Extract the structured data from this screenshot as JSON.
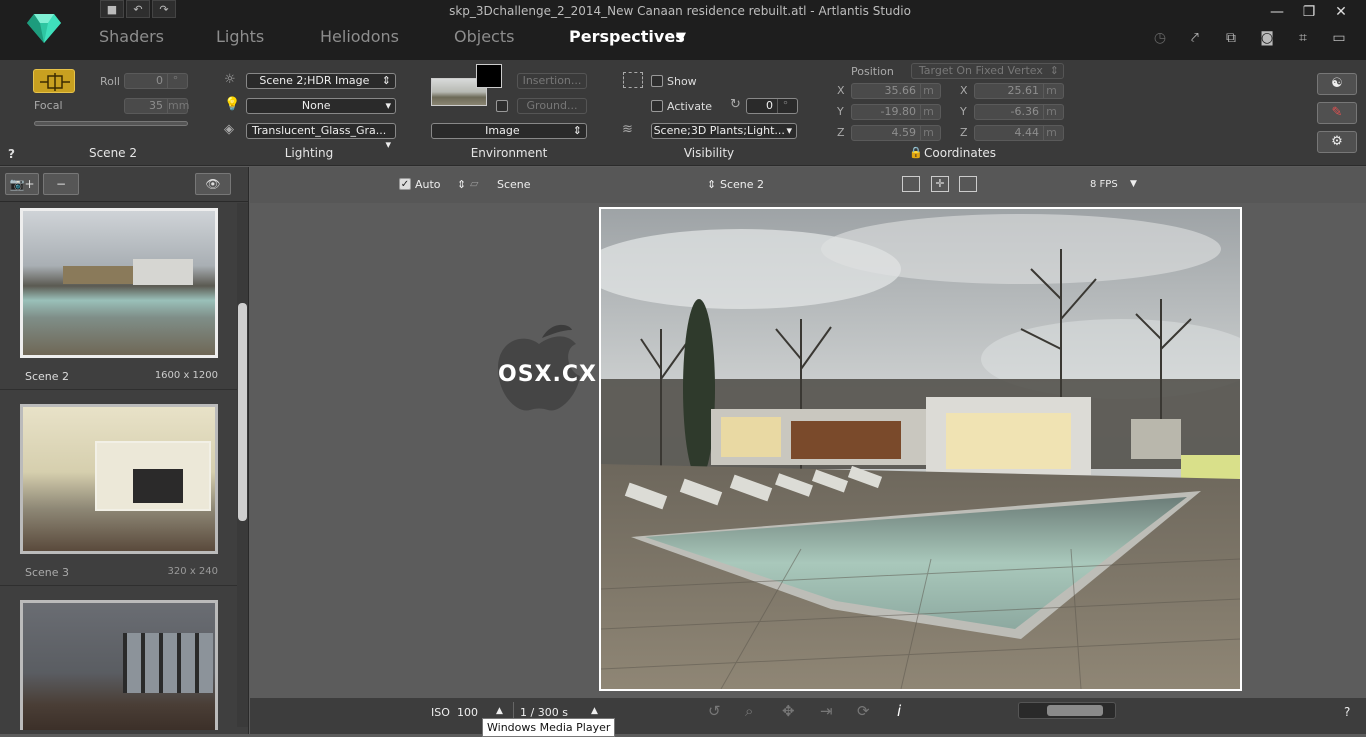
{
  "window": {
    "title": "skp_3Dchallenge_2_2014_New Canaan residence rebuilt.atl - Artlantis Studio",
    "controls": {
      "minimize": "—",
      "maximize": "❐",
      "close": "✕"
    }
  },
  "tabs": [
    {
      "label": "Shaders"
    },
    {
      "label": "Lights"
    },
    {
      "label": "Heliodons"
    },
    {
      "label": "Objects"
    },
    {
      "label": "Perspectives",
      "active": true
    }
  ],
  "tab_menu_arrow": "▼",
  "toolbar": {
    "scene": {
      "section_label": "Scene 2",
      "roll_label": "Roll",
      "roll_value": "0",
      "roll_unit": "°",
      "focal_label": "Focal",
      "focal_value": "35",
      "focal_unit": "mm"
    },
    "lighting": {
      "section_label": "Lighting",
      "heliodon_select": "Scene 2;HDR Image",
      "light_select": "None",
      "shader_select": "Translucent_Glass_Gra..."
    },
    "environment": {
      "section_label": "Environment",
      "mode_select": "Image",
      "insertion_button": "Insertion...",
      "ground_button": "Ground..."
    },
    "visibility": {
      "section_label": "Visibility",
      "show_label": "Show",
      "activate_label": "Activate",
      "angle_value": "0",
      "angle_unit": "°",
      "layers_select": "Scene;3D Plants;Light..."
    },
    "coordinates": {
      "section_label": "Coordinates",
      "position_label": "Position",
      "target_select": "Target On Fixed Vertex",
      "position": {
        "x": "35.66",
        "y": "-19.80",
        "z": "4.59"
      },
      "target": {
        "x": "25.61",
        "y": "-6.36",
        "z": "4.44"
      },
      "unit": "m",
      "axis_labels": {
        "x": "X",
        "y": "Y",
        "z": "Z"
      }
    },
    "help": "?"
  },
  "sidebar": {
    "add_button": "📷+",
    "remove_button": "−",
    "eye_button": "👁",
    "scenes": [
      {
        "name": "Scene 2",
        "size": "1600 x 1200",
        "active": true
      },
      {
        "name": "Scene 3",
        "size": "320 x 240",
        "active": false
      },
      {
        "name": "",
        "size": "",
        "active": false
      }
    ]
  },
  "viewport_header": {
    "auto_label": "Auto",
    "heliodon_scene": "Scene",
    "scene_select": "Scene 2",
    "fps": "8 FPS"
  },
  "watermark": {
    "text": "OSX.CX"
  },
  "bottom_bar": {
    "iso_label": "ISO",
    "iso_value": "100",
    "shutter_value": "1 / 300 s",
    "help": "?"
  },
  "tooltip": "Windows Media Player",
  "colors": {
    "accent": "#2ec6a2",
    "active_thumb_border": "#eeeeee",
    "background_panel": "#3a3a3a",
    "viewport_bg": "#5c5c5c"
  }
}
